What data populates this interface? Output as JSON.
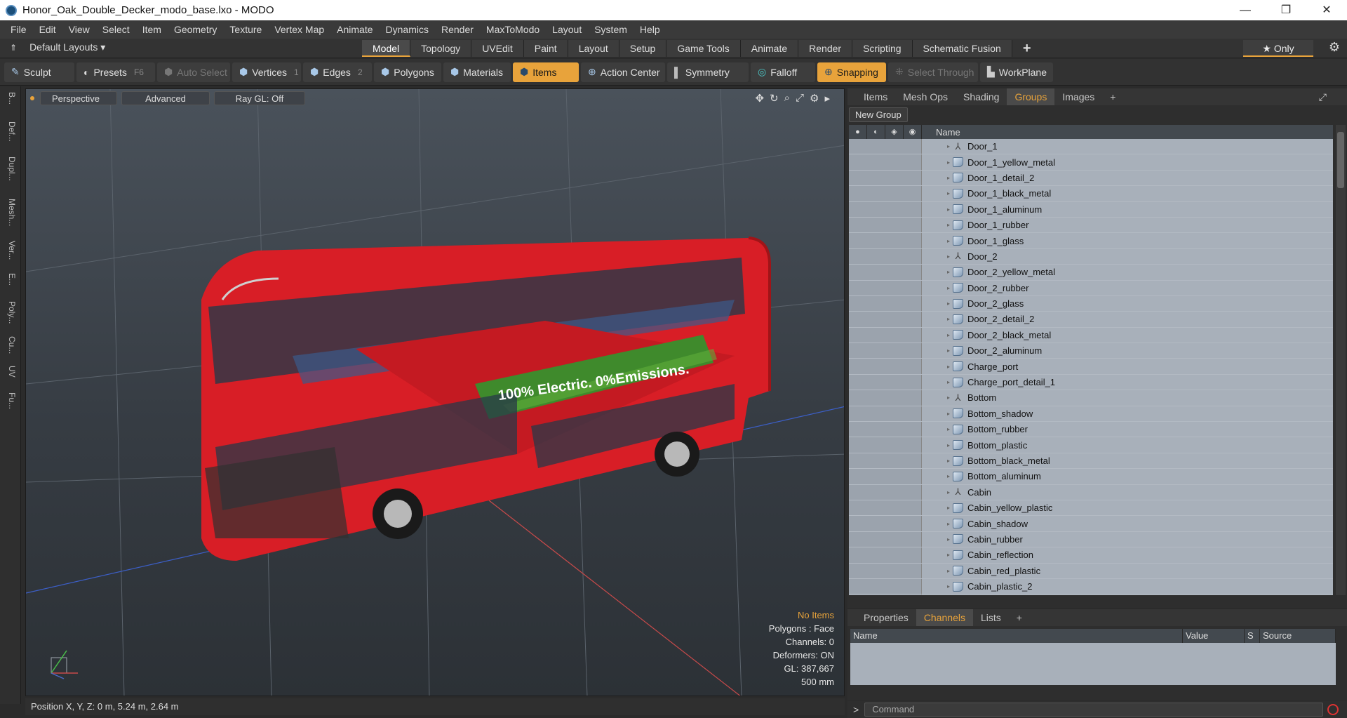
{
  "window": {
    "title": "Honor_Oak_Double_Decker_modo_base.lxo - MODO",
    "minimize": "—",
    "restore": "❐",
    "close": "✕"
  },
  "menu": [
    "File",
    "Edit",
    "View",
    "Select",
    "Item",
    "Geometry",
    "Texture",
    "Vertex Map",
    "Animate",
    "Dynamics",
    "Render",
    "MaxToModo",
    "Layout",
    "System",
    "Help"
  ],
  "layout": {
    "label": "Default Layouts ▾",
    "tabs": [
      "Model",
      "Topology",
      "UVEdit",
      "Paint",
      "Layout",
      "Setup",
      "Game Tools",
      "Animate",
      "Render",
      "Scripting",
      "Schematic Fusion"
    ],
    "active_tab": "Model",
    "add": "+",
    "only": "★  Only"
  },
  "toolbar": {
    "sculpt": "Sculpt",
    "presets": "Presets",
    "presets_key": "F6",
    "auto_select": "Auto Select",
    "vertices": "Vertices",
    "vertices_num": "1",
    "edges": "Edges",
    "edges_num": "2",
    "polygons": "Polygons",
    "materials": "Materials",
    "items": "Items",
    "action_center": "Action Center",
    "symmetry": "Symmetry",
    "falloff": "Falloff",
    "snapping": "Snapping",
    "select_through": "Select Through",
    "workplane": "WorkPlane"
  },
  "leftstrip": [
    "B...",
    "Def...",
    "Dupl...",
    "Mesh...",
    "Ver...",
    "E...",
    "Poly...",
    "Cu...",
    "UV",
    "Fu..."
  ],
  "viewport": {
    "perspective": "Perspective",
    "advanced": "Advanced",
    "raygl": "Ray GL: Off",
    "info": {
      "no_items": "No Items",
      "polygons": "Polygons : Face",
      "channels": "Channels: 0",
      "deformers": "Deformers: ON",
      "gl": "GL: 387,667",
      "scale": "500 mm"
    },
    "banner": "100% Electric. 0%Emissions."
  },
  "status": {
    "position": "Position X, Y, Z:   0 m, 5.24 m, 2.64 m"
  },
  "groups_panel": {
    "tabs": [
      "Items",
      "Mesh Ops",
      "Shading",
      "Groups",
      "Images"
    ],
    "active_tab": "Groups",
    "add": "+",
    "new_group": "New Group",
    "name_header": "Name",
    "rows": [
      {
        "name": "Door_1",
        "type": "locator"
      },
      {
        "name": "Door_1_yellow_metal",
        "type": "mesh"
      },
      {
        "name": "Door_1_detail_2",
        "type": "mesh"
      },
      {
        "name": "Door_1_black_metal",
        "type": "mesh"
      },
      {
        "name": "Door_1_aluminum",
        "type": "mesh"
      },
      {
        "name": "Door_1_rubber",
        "type": "mesh"
      },
      {
        "name": "Door_1_glass",
        "type": "mesh"
      },
      {
        "name": "Door_2",
        "type": "locator"
      },
      {
        "name": "Door_2_yellow_metal",
        "type": "mesh"
      },
      {
        "name": "Door_2_rubber",
        "type": "mesh"
      },
      {
        "name": "Door_2_glass",
        "type": "mesh"
      },
      {
        "name": "Door_2_detail_2",
        "type": "mesh"
      },
      {
        "name": "Door_2_black_metal",
        "type": "mesh"
      },
      {
        "name": "Door_2_aluminum",
        "type": "mesh"
      },
      {
        "name": "Charge_port",
        "type": "mesh"
      },
      {
        "name": "Charge_port_detail_1",
        "type": "mesh"
      },
      {
        "name": "Bottom",
        "type": "locator"
      },
      {
        "name": "Bottom_shadow",
        "type": "mesh"
      },
      {
        "name": "Bottom_rubber",
        "type": "mesh"
      },
      {
        "name": "Bottom_plastic",
        "type": "mesh"
      },
      {
        "name": "Bottom_black_metal",
        "type": "mesh"
      },
      {
        "name": "Bottom_aluminum",
        "type": "mesh"
      },
      {
        "name": "Cabin",
        "type": "locator"
      },
      {
        "name": "Cabin_yellow_plastic",
        "type": "mesh"
      },
      {
        "name": "Cabin_shadow",
        "type": "mesh"
      },
      {
        "name": "Cabin_rubber",
        "type": "mesh"
      },
      {
        "name": "Cabin_reflection",
        "type": "mesh"
      },
      {
        "name": "Cabin_red_plastic",
        "type": "mesh"
      },
      {
        "name": "Cabin_plastic_2",
        "type": "mesh"
      }
    ]
  },
  "properties_panel": {
    "tabs": [
      "Properties",
      "Channels",
      "Lists"
    ],
    "active_tab": "Channels",
    "add": "+",
    "headers": {
      "name": "Name",
      "value": "Value",
      "s": "S",
      "source": "Source"
    }
  },
  "command": {
    "gt": ">",
    "placeholder": "Command"
  },
  "colors": {
    "accent": "#e8a33b",
    "bus_red": "#e0202a",
    "banner_green": "#3f8a2c"
  }
}
